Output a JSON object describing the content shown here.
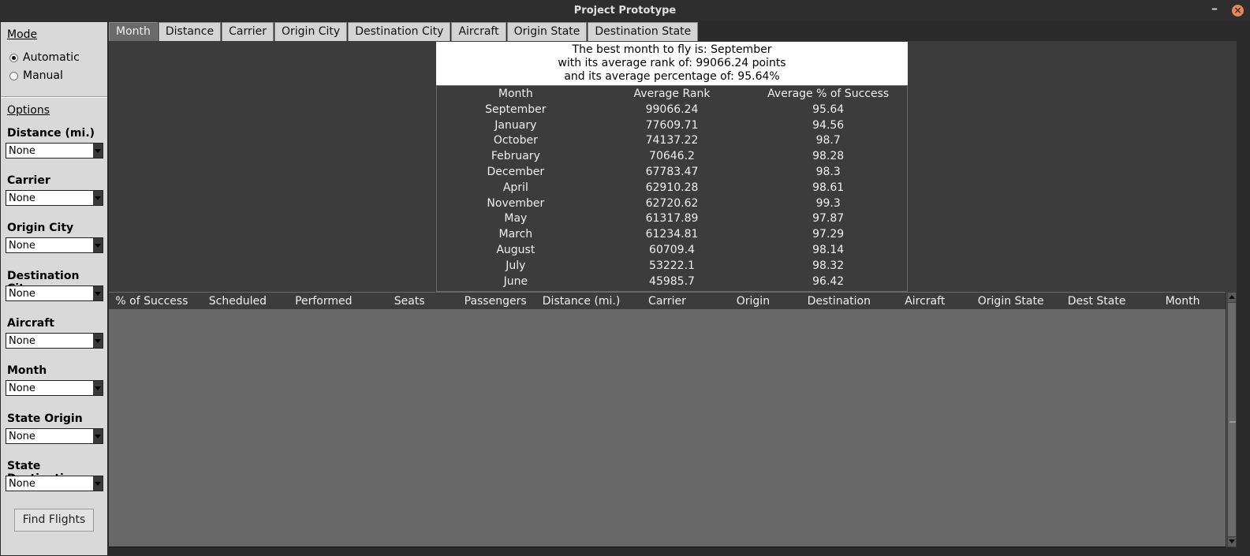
{
  "window": {
    "title": "Project Prototype"
  },
  "sidebar": {
    "mode_label": "Mode",
    "modes": [
      {
        "label": "Automatic",
        "selected": true
      },
      {
        "label": "Manual",
        "selected": false
      }
    ],
    "options_label": "Options",
    "filters": [
      {
        "label": "Distance (mi.)",
        "value": "None"
      },
      {
        "label": "Carrier",
        "value": "None"
      },
      {
        "label": "Origin City",
        "value": "None"
      },
      {
        "label": "Destination City",
        "value": "None"
      },
      {
        "label": "Aircraft",
        "value": "None"
      },
      {
        "label": "Month",
        "value": "None"
      },
      {
        "label": "State Origin",
        "value": "None"
      },
      {
        "label": "State Destination",
        "value": "None"
      }
    ],
    "find_button": "Find Flights"
  },
  "tabs": [
    "Month",
    "Distance",
    "Carrier",
    "Origin City",
    "Destination City",
    "Aircraft",
    "Origin State",
    "Destination State"
  ],
  "active_tab": "Month",
  "summary": {
    "line1": "The best month to fly is: September",
    "line2": "with its average rank of: 99066.24 points",
    "line3": "and its average percentage of: 95.64%"
  },
  "rank_table": {
    "headers": [
      "Month",
      "Average Rank",
      "Average % of Success"
    ],
    "rows": [
      [
        "September",
        "99066.24",
        "95.64"
      ],
      [
        "January",
        "77609.71",
        "94.56"
      ],
      [
        "October",
        "74137.22",
        "98.7"
      ],
      [
        "February",
        "70646.2",
        "98.28"
      ],
      [
        "December",
        "67783.47",
        "98.3"
      ],
      [
        "April",
        "62910.28",
        "98.61"
      ],
      [
        "November",
        "62720.62",
        "99.3"
      ],
      [
        "May",
        "61317.89",
        "97.87"
      ],
      [
        "March",
        "61234.81",
        "97.29"
      ],
      [
        "August",
        "60709.4",
        "98.14"
      ],
      [
        "July",
        "53222.1",
        "98.32"
      ],
      [
        "June",
        "45985.7",
        "96.42"
      ]
    ]
  },
  "flight_table": {
    "headers": [
      "% of Success",
      "Scheduled",
      "Performed",
      "Seats",
      "Passengers",
      "Distance (mi.)",
      "Carrier",
      "Origin",
      "Destination",
      "Aircraft",
      "Origin State",
      "Dest State",
      "Month"
    ]
  }
}
